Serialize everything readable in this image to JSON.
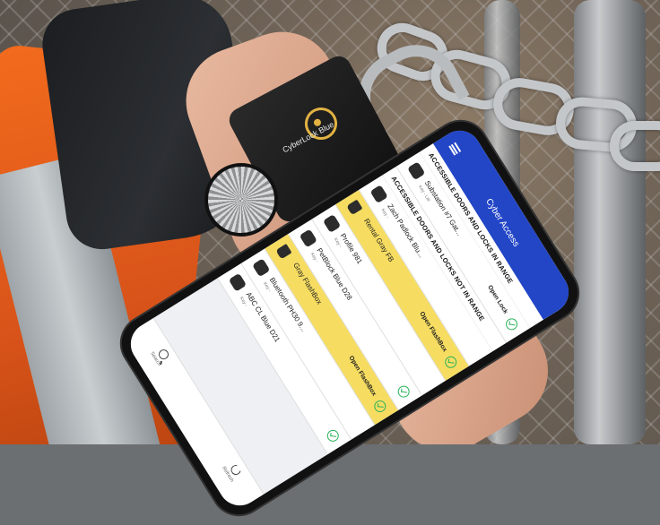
{
  "lock": {
    "brand_text": "CyberLock Blue"
  },
  "app": {
    "title": "Cyber Access",
    "sections": [
      {
        "heading": "ACCESSIBLE DOORS AND LOCKS IN RANGE",
        "rows": [
          {
            "name": "Substation #7 Gat...",
            "subtitle": "Key - Lat",
            "action": "Open Lock",
            "highlight": false,
            "icon": "lock-icon"
          }
        ]
      },
      {
        "heading": "ACCESSIBLE DOORS AND LOCKS NOT IN RANGE",
        "rows": [
          {
            "name": "Zach Padlock Blu...",
            "subtitle": "Key -",
            "action": "",
            "highlight": false,
            "icon": "lock-icon"
          },
          {
            "name": "Rental Gray FB",
            "subtitle": "",
            "action": "Open FlashBox",
            "highlight": true,
            "icon": "padlock-icon"
          },
          {
            "name": "Profile 981",
            "subtitle": "Key -",
            "action": "",
            "highlight": false,
            "icon": "lock-icon"
          },
          {
            "name": "PetBlock Blue D28",
            "subtitle": "Key -",
            "action": "",
            "highlight": false,
            "icon": "lock-icon"
          },
          {
            "name": "Gray FlashBox",
            "subtitle": "",
            "action": "Open FlashBox",
            "highlight": true,
            "icon": "padlock-icon"
          },
          {
            "name": "Bluetooth PH30 9...",
            "subtitle": "Key -",
            "action": "",
            "highlight": false,
            "icon": "lock-icon"
          },
          {
            "name": "ABC CL Blue D21",
            "subtitle": "Key -",
            "action": "",
            "highlight": false,
            "icon": "lock-icon"
          }
        ]
      }
    ],
    "bottom_nav": [
      {
        "label": "Search",
        "icon": "search-icon"
      },
      {
        "label": "Refresh",
        "icon": "refresh-icon"
      }
    ]
  }
}
